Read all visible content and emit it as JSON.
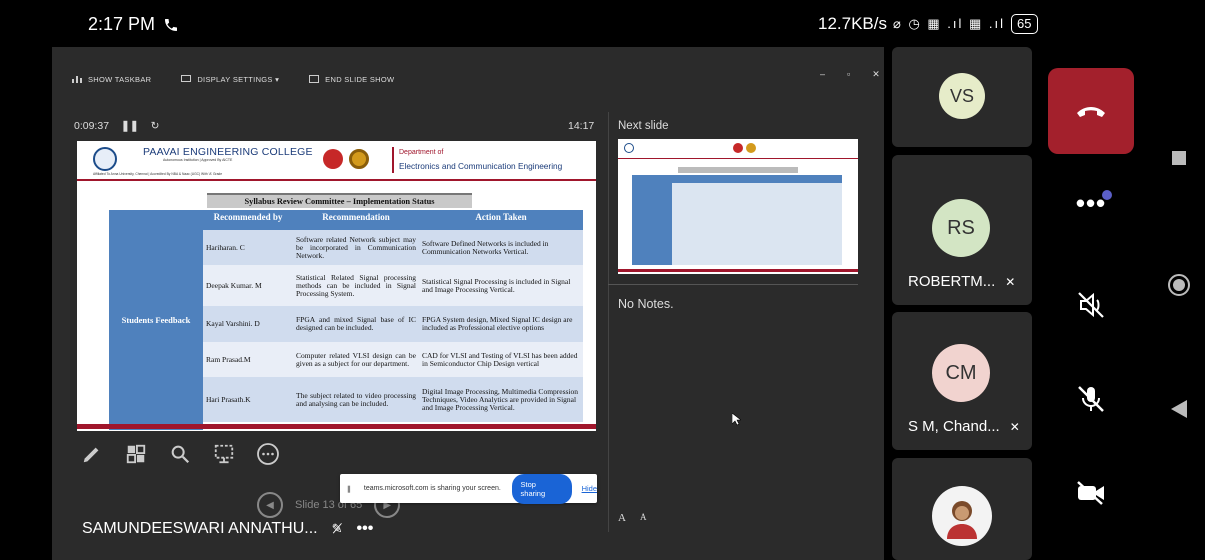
{
  "status": {
    "time": "2:17 PM",
    "speed": "12.7KB/s",
    "battery": "65"
  },
  "toolbar": {
    "show_taskbar": "SHOW TASKBAR",
    "display_settings": "DISPLAY SETTINGS ▾",
    "end_show": "END SLIDE SHOW"
  },
  "timer": {
    "elapsed": "0:09:37",
    "clock": "14:17"
  },
  "slide": {
    "college": "PAAVAI ENGINEERING COLLEGE",
    "college_sub": "Autonomous Institution | Approved By AICTE",
    "college_sub2": "Affiliated To Anna University, Chennai | Accredited By NBA & Naac (UGC) With 'A' Grade",
    "dept_line1": "Department of",
    "dept_line2": "Electronics and Communication Engineering",
    "title": "Syllabus Review Committee – Implementation Status",
    "headers": [
      "Recommended by",
      "Recommendation",
      "Action Taken"
    ],
    "side_label": "Students Feedback",
    "rows": [
      {
        "by": "Hariharan. C",
        "rec": "Software related Network subject may be incorporated in Communication Network.",
        "action": "Software Defined Networks is included in Communication Networks Vertical."
      },
      {
        "by": "Deepak Kumar. M",
        "rec": "Statistical Related Signal processing methods can be included in Signal Processing System.",
        "action": "Statistical Signal Processing is included in Signal and Image Processing Vertical."
      },
      {
        "by": "Kayal Varshini. D",
        "rec": "FPGA and mixed Signal base of IC designed can be included.",
        "action": "FPGA System design, Mixed Signal IC design are included as Professional elective options"
      },
      {
        "by": "Ram Prasad.M",
        "rec": "Computer related VLSI design can be given as a subject for our department.",
        "action": "CAD for VLSI and Testing of VLSI has been added in Semiconductor Chip Design vertical"
      },
      {
        "by": "Hari Prasath.K",
        "rec": "The subject related to video processing and analysing can be included.",
        "action": "Digital Image Processing, Multimedia Compression Techniques, Video Analytics are provided in Signal and Image Processing Vertical."
      }
    ]
  },
  "next_slide_label": "Next slide",
  "notes": "No Notes.",
  "font_buttons": [
    "A",
    "A"
  ],
  "nav": {
    "slide_text": "Slide 13 of 65"
  },
  "share_banner": {
    "text": "teams.microsoft.com is sharing your screen.",
    "stop": "Stop sharing",
    "hide": "Hide"
  },
  "presenter": {
    "name": "SAMUNDEESWARI ANNATHU...",
    "more": "•••"
  },
  "participants": [
    {
      "initials": "VS",
      "name": "",
      "color": "#e6ecc9"
    },
    {
      "initials": "RS",
      "name": "ROBERTM...",
      "color": "#d3e5c4"
    },
    {
      "initials": "CM",
      "name": "S M, Chand...",
      "color": "#f1d3cf"
    }
  ],
  "colors": {
    "end_call": "#a3202c",
    "accent": "#5b5fc7"
  }
}
